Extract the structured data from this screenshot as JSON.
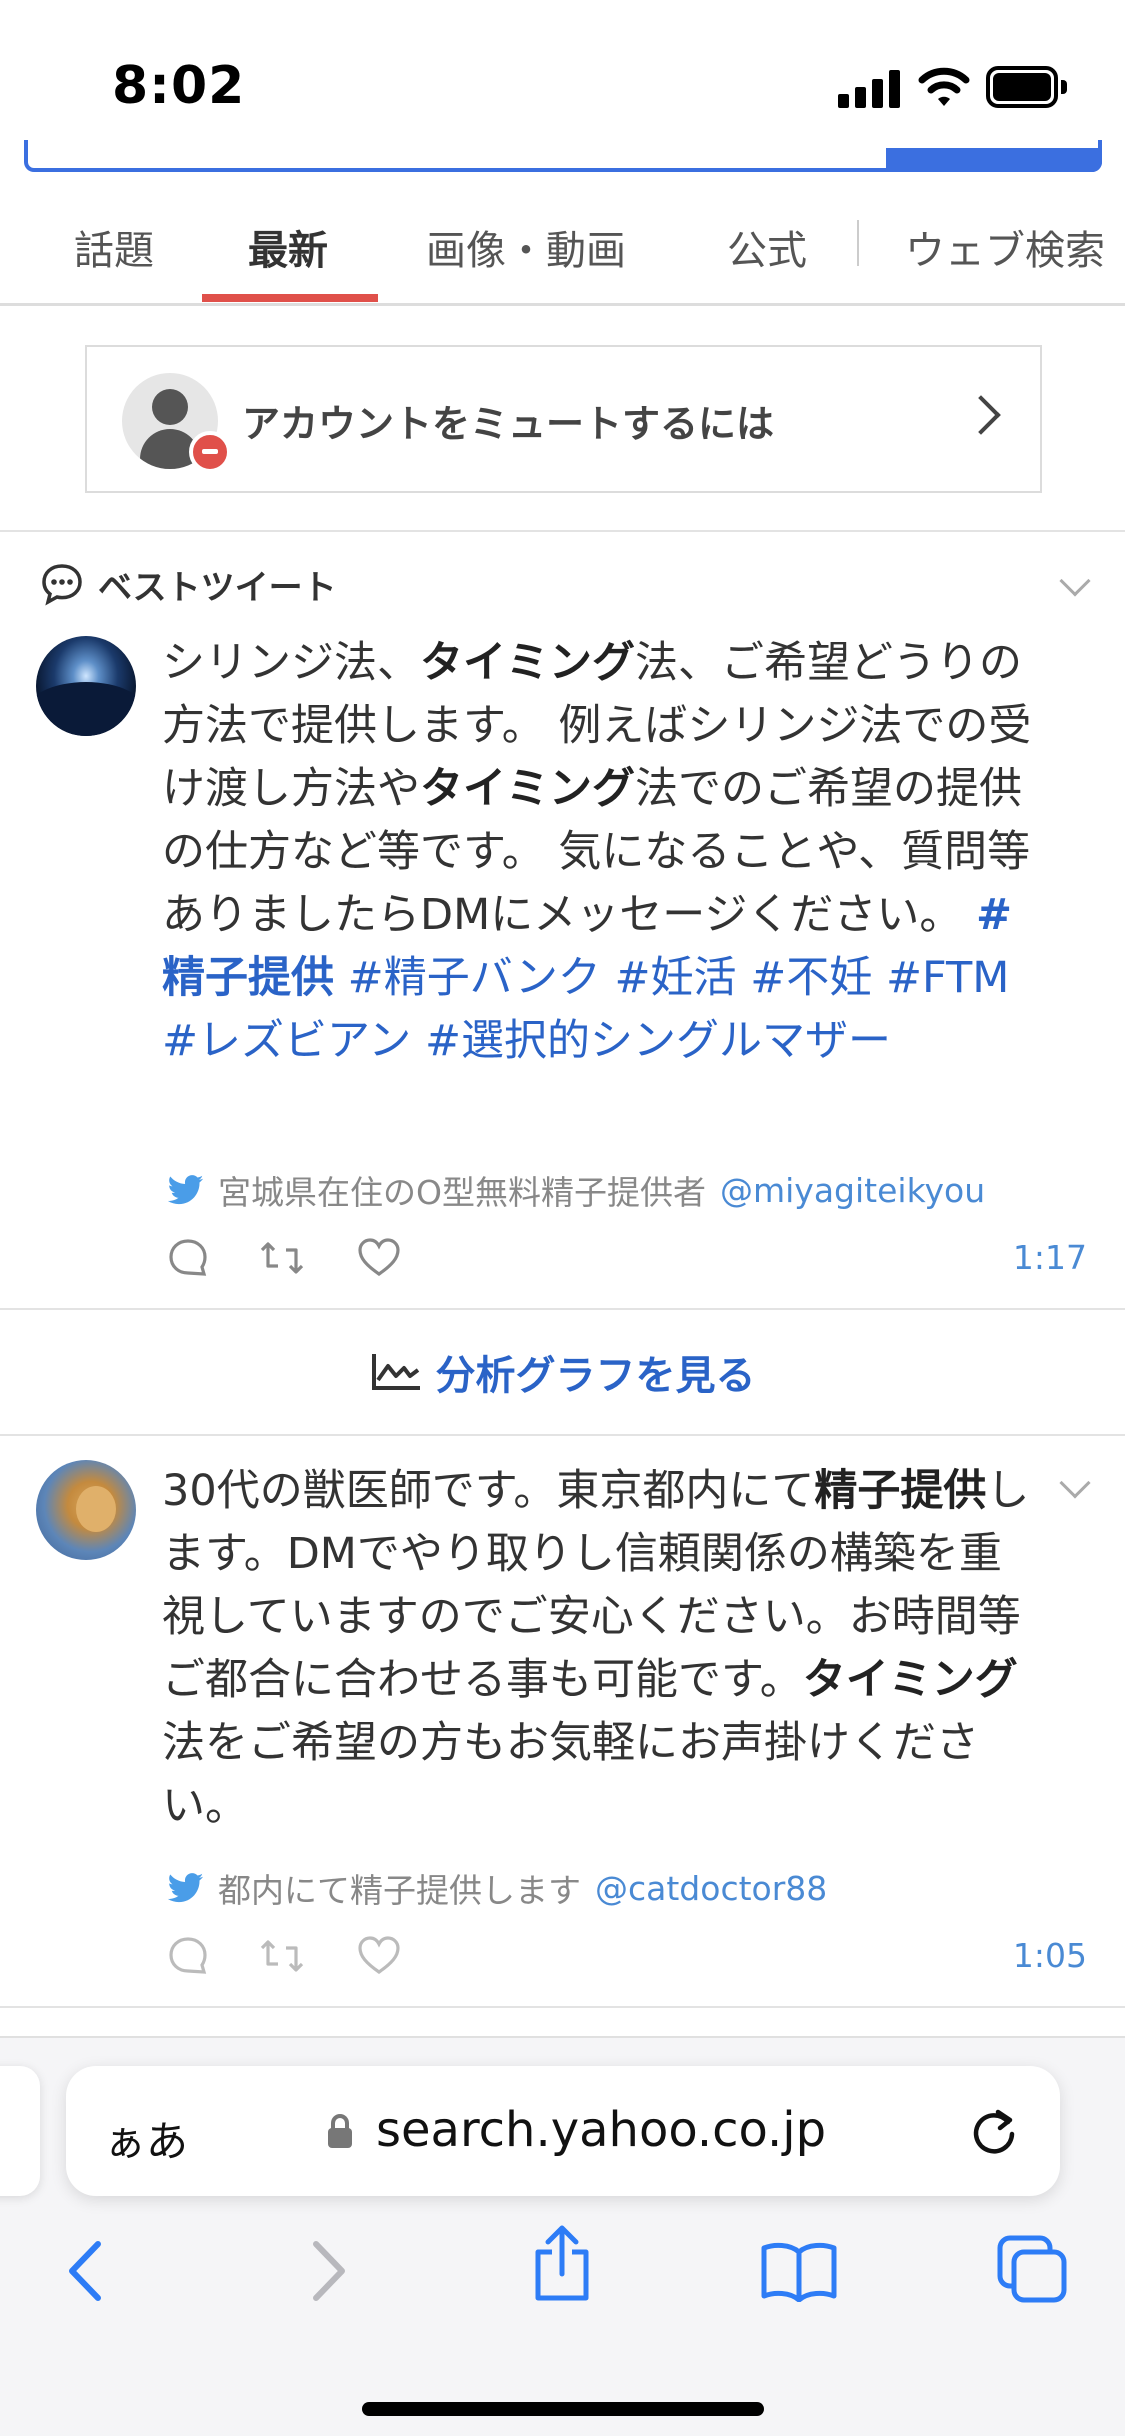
{
  "status_bar": {
    "time": "8:02"
  },
  "tabs": [
    {
      "label": "話題",
      "active": false
    },
    {
      "label": "最新",
      "active": true
    },
    {
      "label": "画像・動画",
      "active": false
    },
    {
      "label": "公式",
      "active": false
    },
    {
      "label": "ウェブ検索",
      "active": false
    }
  ],
  "mute_banner": {
    "label": "アカウントをミュートするには"
  },
  "best_tweet": {
    "section_label": "ベストツイート",
    "text_parts": [
      "シリンジ法、",
      "タイミング",
      "法、ご希望どうりの方法で提供します。 例えばシリンジ法での受け渡し方法や",
      "タイミング",
      "法でのご希望の提供の仕方など等です。 気になることや、質問等ありましたらDMにメッセージください。 "
    ],
    "hashtags": [
      "#精子提供",
      "#精子バンク",
      "#妊活",
      "#不妊",
      "#FTM",
      "#レズビアン",
      "#選択的シングルマザー"
    ],
    "author_name": "宮城県在住のO型無料精子提供者",
    "author_handle": "@miyagiteikyou",
    "time": "1:17"
  },
  "analysis_link": {
    "label": "分析グラフを見る"
  },
  "tweet2": {
    "text_parts": [
      "30代の獣医師です。東京都内にて",
      "精子提供",
      "します。DMでやり取りし信頼関係の構築を重視していますのでご安心ください。お時間等ご都合に合わせる事も可能です。",
      "タイミング",
      "法をご希望の方もお気軽にお声掛けください。"
    ],
    "author_name": "都内にて精子提供します",
    "author_handle": "@catdoctor88",
    "time": "1:05"
  },
  "browser": {
    "text_size_label": "ぁあ",
    "url": "search.yahoo.co.jp"
  },
  "colors": {
    "accent_blue": "#2a63c7",
    "tab_underline": "#e0504a",
    "link_blue": "#4a8ad4"
  }
}
